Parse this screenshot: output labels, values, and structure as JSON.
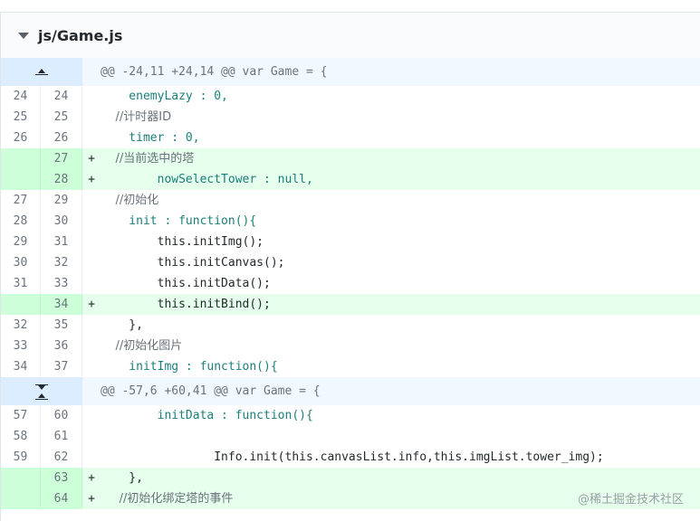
{
  "file": {
    "name": "js/Game.js"
  },
  "hunks": [
    {
      "header": "@@ -24,11 +24,14 @@ var Game = {"
    },
    {
      "header": "@@ -57,6 +60,41 @@ var Game = {"
    }
  ],
  "lines": [
    {
      "old": "24",
      "new": "24",
      "marker": "",
      "text": "    enemyLazy : 0,"
    },
    {
      "old": "25",
      "new": "25",
      "marker": "",
      "text": "    //计时器ID"
    },
    {
      "old": "26",
      "new": "26",
      "marker": "",
      "text": "    timer : 0,"
    },
    {
      "old": "",
      "new": "27",
      "marker": "+",
      "text": "    //当前选中的塔"
    },
    {
      "old": "",
      "new": "28",
      "marker": "+",
      "text": "        nowSelectTower : null,"
    },
    {
      "old": "27",
      "new": "29",
      "marker": "",
      "text": "    //初始化"
    },
    {
      "old": "28",
      "new": "30",
      "marker": "",
      "text": "    init : function(){"
    },
    {
      "old": "29",
      "new": "31",
      "marker": "",
      "text": "        this.initImg();"
    },
    {
      "old": "30",
      "new": "32",
      "marker": "",
      "text": "        this.initCanvas();"
    },
    {
      "old": "31",
      "new": "33",
      "marker": "",
      "text": "        this.initData();"
    },
    {
      "old": "",
      "new": "34",
      "marker": "+",
      "text": "        this.initBind();"
    },
    {
      "old": "32",
      "new": "35",
      "marker": "",
      "text": "    },"
    },
    {
      "old": "33",
      "new": "36",
      "marker": "",
      "text": "    //初始化图片"
    },
    {
      "old": "34",
      "new": "37",
      "marker": "",
      "text": "    initImg : function(){"
    },
    {
      "old": "57",
      "new": "60",
      "marker": "",
      "text": "        initData : function(){"
    },
    {
      "old": "58",
      "new": "61",
      "marker": "",
      "text": ""
    },
    {
      "old": "59",
      "new": "62",
      "marker": "",
      "text": "                Info.init(this.canvasList.info,this.imgList.tower_img);"
    },
    {
      "old": "",
      "new": "63",
      "marker": "+",
      "text": "    },"
    },
    {
      "old": "",
      "new": "64",
      "marker": "+",
      "text": "     //初始化绑定塔的事件"
    }
  ],
  "watermark": "@稀土掘金技术社区",
  "colors": {
    "addBg": "#e6ffec",
    "addGutter": "#cdffd8",
    "hunkBg": "#f1f8ff",
    "expandBg": "#dbedff"
  }
}
